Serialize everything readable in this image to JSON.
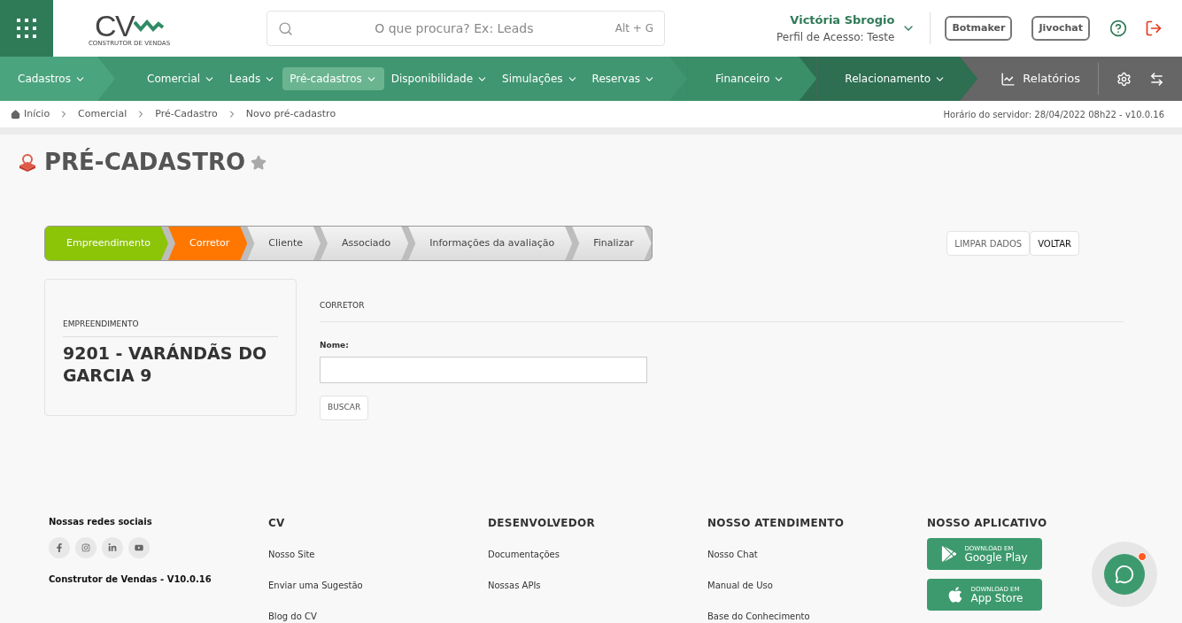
{
  "header": {
    "logo": {
      "mark": "CV",
      "tagline": "CONSTRUTOR DE VENDAS"
    },
    "search": {
      "placeholder": "O que procura? Ex: Leads",
      "shortcut": "Alt + G"
    },
    "user": {
      "name": "Victória Sbrogio",
      "profile": "Perfil de Acesso: Teste"
    },
    "buttons": [
      "Botmaker",
      "Jivochat"
    ]
  },
  "nav": {
    "items": [
      {
        "label": "Cadastros",
        "color": "#4aa47d",
        "selected": false
      },
      {
        "label": "Comercial",
        "color": "#3f9670",
        "selected": false
      },
      {
        "label": "Leads",
        "color": "#3f9670",
        "selected": false
      },
      {
        "label": "Pré-cadastros",
        "color": "#3f9670",
        "selected": true
      },
      {
        "label": "Disponibilidade",
        "color": "#3f9670",
        "selected": false
      },
      {
        "label": "Simulações",
        "color": "#3f9670",
        "selected": false
      },
      {
        "label": "Reservas",
        "color": "#3f9670",
        "selected": false
      },
      {
        "label": "Financeiro",
        "color": "#3a8f69",
        "selected": false
      },
      {
        "label": "Relacionamento",
        "color": "#2e6e51",
        "selected": false
      }
    ],
    "reports": "Relatórios"
  },
  "breadcrumb": [
    "Início",
    "Comercial",
    "Pré-Cadastro",
    "Novo pré-cadastro"
  ],
  "server_time": "Horário do servidor: 28/04/2022 08h22 - v10.0.16",
  "page": {
    "title": "PRÉ-CADASTRO",
    "favorite": false
  },
  "steps": [
    {
      "label": "Empreendimento",
      "completed": true,
      "selected": false
    },
    {
      "label": "Corretor",
      "completed": false,
      "selected": true
    },
    {
      "label": "Cliente",
      "completed": false,
      "selected": false
    },
    {
      "label": "Associado",
      "completed": false,
      "selected": false
    },
    {
      "label": "Informações da avaliação",
      "completed": false,
      "selected": false
    },
    {
      "label": "Finalizar",
      "completed": false,
      "selected": false
    }
  ],
  "actions": [
    "LIMPAR DADOS",
    "VOLTAR"
  ],
  "summary": {
    "label": "EMPREENDIMENTO",
    "value": "9201 - VARÁNDÃS DO GARCIA 9"
  },
  "form": {
    "section": "CORRETOR",
    "field_label": "Nome:",
    "button": "BUSCAR"
  },
  "footer": {
    "social_title": "Nossas redes sociais",
    "version": "Construtor de Vendas - V10.0.16",
    "columns": [
      {
        "title": "CV",
        "links": [
          "Nosso Site",
          "Enviar uma Sugestão",
          "Blog do CV"
        ]
      },
      {
        "title": "DESENVOLVEDOR",
        "links": [
          "Documentações",
          "Nossas APIs"
        ]
      },
      {
        "title": "NOSSO ATENDIMENTO",
        "links": [
          "Nosso Chat",
          "Manual de Uso",
          "Base do Conhecimento"
        ]
      }
    ],
    "app": {
      "title": "NOSSO APLICATIVO",
      "stores": [
        {
          "kind": "android",
          "small": "DOWNLOAD EM",
          "name": "Google Play"
        },
        {
          "kind": "apple",
          "small": "DOWNLOAD EM",
          "name": "App Store"
        }
      ]
    }
  }
}
